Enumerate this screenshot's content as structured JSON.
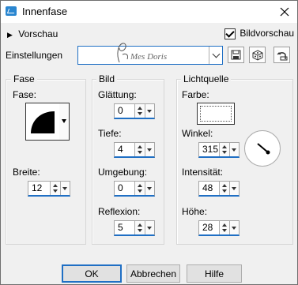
{
  "window": {
    "title": "Innenfase"
  },
  "header": {
    "preview_toggle_label": "Vorschau",
    "bildvorschau_label": "Bildvorschau",
    "bildvorschau_checked": true
  },
  "settings": {
    "label": "Einstellungen",
    "combo_value": ""
  },
  "fase": {
    "group_label": "Fase",
    "fase_label": "Fase:",
    "breite_label": "Breite:",
    "breite_value": "12"
  },
  "bild": {
    "group_label": "Bild",
    "glaettung_label": "Glättung:",
    "glaettung_value": "0",
    "tiefe_label": "Tiefe:",
    "tiefe_value": "4",
    "umgebung_label": "Umgebung:",
    "umgebung_value": "0",
    "reflexion_label": "Reflexion:",
    "reflexion_value": "5"
  },
  "licht": {
    "group_label": "Lichtquelle",
    "farbe_label": "Farbe:",
    "farbe_color": "#ffffff",
    "winkel_label": "Winkel:",
    "winkel_value": "315",
    "intensitaet_label": "Intensität:",
    "intensitaet_value": "48",
    "hoehe_label": "Höhe:",
    "hoehe_value": "28"
  },
  "footer": {
    "ok_label": "OK",
    "cancel_label": "Abbrechen",
    "help_label": "Hilfe"
  },
  "colors": {
    "accent": "#1f6fc4",
    "title_bg": "#ffffff",
    "dialog_bg": "#f0f0f0"
  }
}
